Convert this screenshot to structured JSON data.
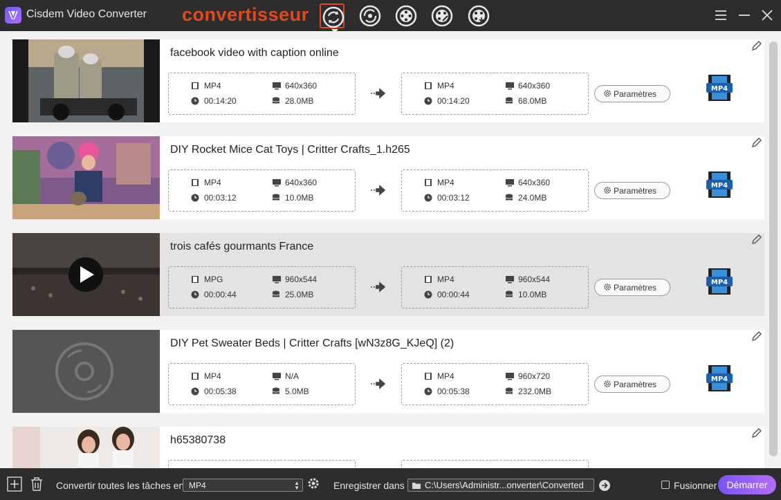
{
  "app": {
    "title": "Cisdem Video Converter",
    "mode_label": "convertisseur"
  },
  "toolbar": {
    "tools": [
      {
        "name": "convert-tool",
        "active": true
      },
      {
        "name": "download-tool",
        "active": false
      },
      {
        "name": "dvd-tool",
        "active": false
      },
      {
        "name": "edit-tool",
        "active": false
      },
      {
        "name": "burn-tool",
        "active": false
      }
    ]
  },
  "items": [
    {
      "title": "facebook video with caption online",
      "source": {
        "format": "MP4",
        "resolution": "640x360",
        "duration": "00:14:20",
        "size": "28.0MB"
      },
      "output": {
        "format": "MP4",
        "resolution": "640x360",
        "duration": "00:14:20",
        "size": "68.0MB"
      },
      "settings_label": "Paramètres",
      "format_badge": "MP4",
      "selected": false
    },
    {
      "title": "DIY Rocket Mice Cat Toys  |  Critter Crafts_1.h265",
      "source": {
        "format": "MP4",
        "resolution": "640x360",
        "duration": "00:03:12",
        "size": "10.0MB"
      },
      "output": {
        "format": "MP4",
        "resolution": "640x360",
        "duration": "00:03:12",
        "size": "24.0MB"
      },
      "settings_label": "Paramètres",
      "format_badge": "MP4",
      "selected": false
    },
    {
      "title": "trois cafés gourmants France",
      "source": {
        "format": "MPG",
        "resolution": "960x544",
        "duration": "00:00:44",
        "size": "25.0MB"
      },
      "output": {
        "format": "MP4",
        "resolution": "960x544",
        "duration": "00:00:44",
        "size": "10.0MB"
      },
      "settings_label": "Paramètres",
      "format_badge": "MP4",
      "selected": true
    },
    {
      "title": "DIY Pet Sweater Beds  |  Critter Crafts [wN3z8G_KJeQ] (2)",
      "source": {
        "format": "MP4",
        "resolution": "N/A",
        "duration": "00:05:38",
        "size": "5.0MB"
      },
      "output": {
        "format": "MP4",
        "resolution": "960x720",
        "duration": "00:05:38",
        "size": "232.0MB"
      },
      "settings_label": "Paramètres",
      "format_badge": "MP4",
      "selected": false
    },
    {
      "title": "h65380738",
      "source": {
        "format": "",
        "resolution": "",
        "duration": "",
        "size": ""
      },
      "output": {
        "format": "",
        "resolution": "",
        "duration": "",
        "size": ""
      },
      "settings_label": "",
      "format_badge": "",
      "selected": false
    }
  ],
  "bottom": {
    "convert_all_label": "Convertir toutes les tâches en",
    "convert_all_value": "MP4",
    "save_label": "Enregistrer dans",
    "save_path": "C:\\Users\\Administr...onverter\\Converted",
    "merge_label": "Fusionner",
    "start_label": "Démarrer"
  }
}
